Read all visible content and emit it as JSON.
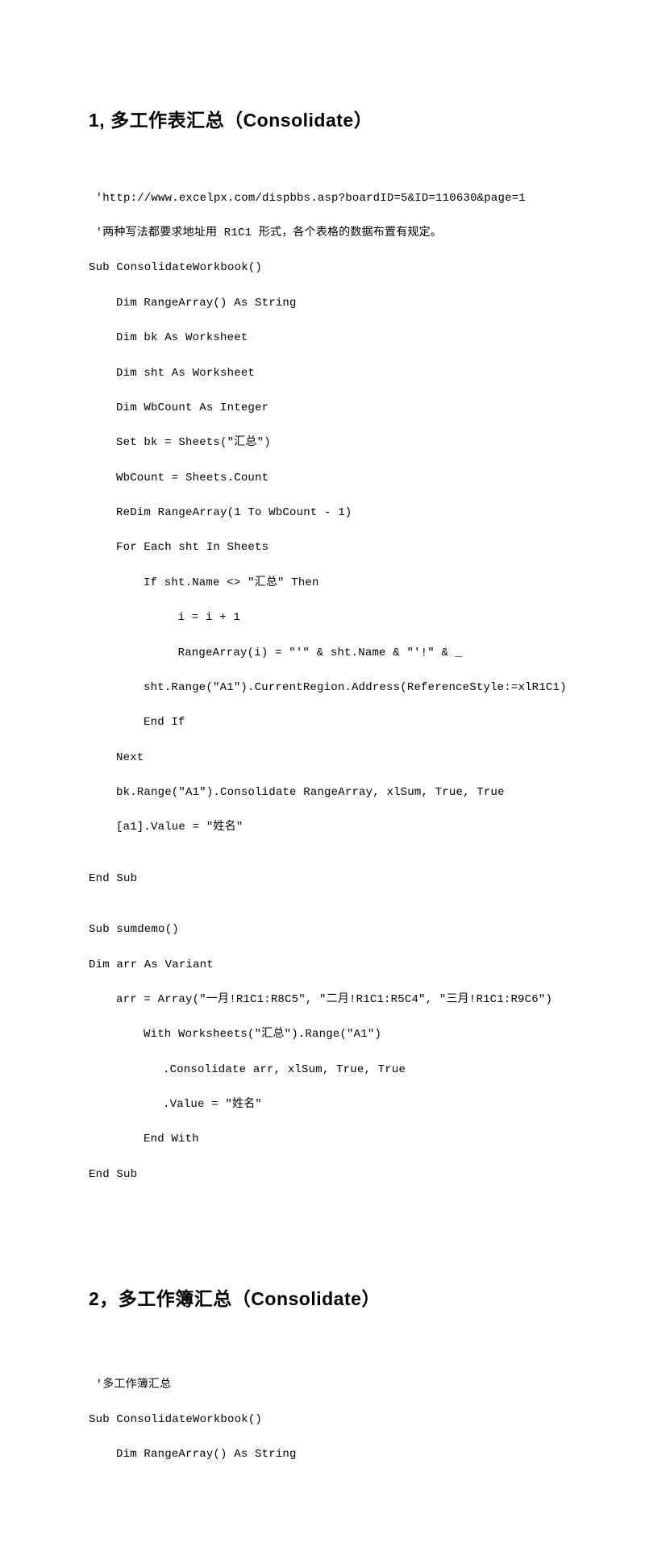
{
  "heading1": "1,  多工作表汇总（Consolidate）",
  "heading2": "2，多工作簿汇总（Consolidate）",
  "section1": {
    "line1": " 'http://www.excelpx.com/dispbbs.asp?boardID=5&ID=110630&page=1",
    "line2": " '两种写法都要求地址用 R1C1 形式，各个表格的数据布置有规定。",
    "line3": "Sub ConsolidateWorkbook()",
    "line4": "Dim RangeArray() As String",
    "line5": "Dim bk As Worksheet",
    "line6": "Dim sht As Worksheet",
    "line7": "Dim WbCount As Integer",
    "line8": "Set bk = Sheets(\"汇总\")",
    "line9": "WbCount = Sheets.Count",
    "line10": "ReDim RangeArray(1 To WbCount - 1)",
    "line11": "For Each sht In Sheets",
    "line12": "If sht.Name <> \"汇总\" Then",
    "line13": " i = i + 1",
    "line14": " RangeArray(i) = \"'\" & sht.Name & \"'!\" & _",
    "line15": "sht.Range(\"A1\").CurrentRegion.Address(ReferenceStyle:=xlR1C1)",
    "line16": "End If",
    "line17": "Next",
    "line18": "bk.Range(\"A1\").Consolidate RangeArray, xlSum, True, True",
    "line19": "[a1].Value = \"姓名\"",
    "line20": "End Sub",
    "line21": "Sub sumdemo()",
    "line22": "Dim arr As Variant",
    "line23": "arr = Array(\"一月!R1C1:R8C5\", \"二月!R1C1:R5C4\", \"三月!R1C1:R9C6\")",
    "line24": "With Worksheets(\"汇总\").Range(\"A1\")",
    "line25": ".Consolidate arr, xlSum, True, True",
    "line26": ".Value = \"姓名\"",
    "line27": "End With",
    "line28": "End Sub"
  },
  "section2": {
    "line1": " '多工作簿汇总",
    "line2": "Sub ConsolidateWorkbook()",
    "line3": "Dim RangeArray() As String"
  }
}
